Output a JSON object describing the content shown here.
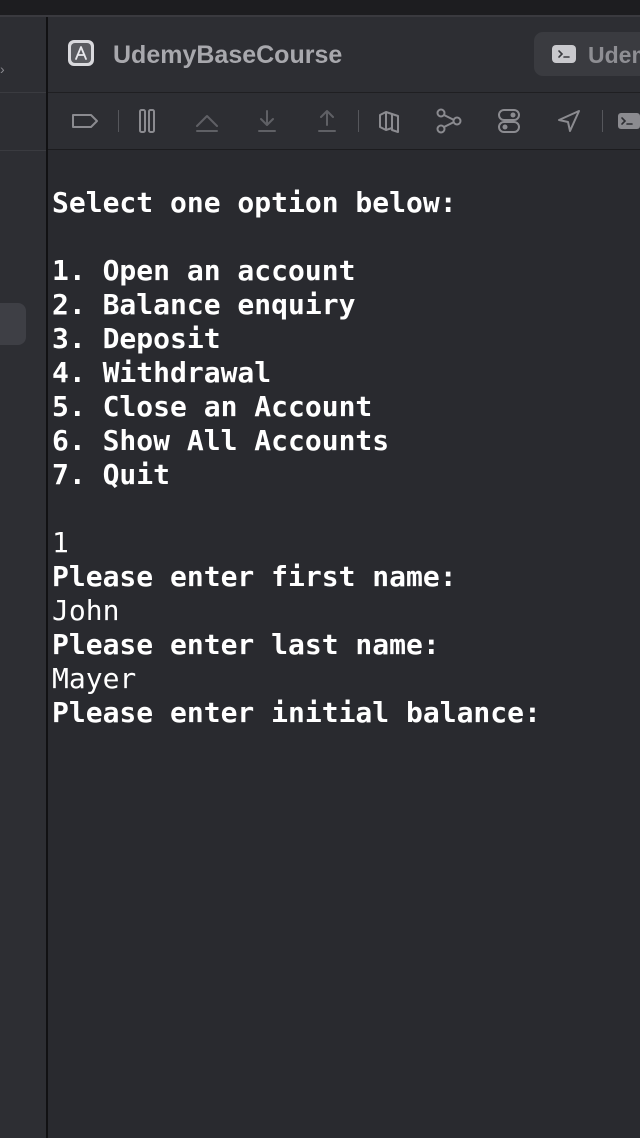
{
  "window": {
    "title": "UdemyBaseCourse"
  },
  "tab": {
    "label": "Udem",
    "icon": "terminal-icon"
  },
  "sidebar": {
    "icon": "chevron-icon"
  },
  "toolbar": {
    "icons": [
      "tag-icon",
      "pause-icon",
      "step-over-icon",
      "step-into-icon",
      "step-out-icon",
      "view-debugger-icon",
      "memory-graph-icon",
      "environment-toggle-icon",
      "location-icon",
      "terminal-icon"
    ]
  },
  "console": {
    "lines": [
      {
        "text": "Select one option below:",
        "bold": true
      },
      {
        "text": "",
        "bold": false
      },
      {
        "text": "1. Open an account",
        "bold": true
      },
      {
        "text": "2. Balance enquiry",
        "bold": true
      },
      {
        "text": "3. Deposit",
        "bold": true
      },
      {
        "text": "4. Withdrawal",
        "bold": true
      },
      {
        "text": "5. Close an Account",
        "bold": true
      },
      {
        "text": "6. Show All Accounts",
        "bold": true
      },
      {
        "text": "7. Quit",
        "bold": true
      },
      {
        "text": "",
        "bold": false
      },
      {
        "text": "1",
        "bold": false
      },
      {
        "text": "Please enter first name:",
        "bold": true
      },
      {
        "text": "John",
        "bold": false
      },
      {
        "text": "Please enter last name:",
        "bold": true
      },
      {
        "text": "Mayer",
        "bold": false
      },
      {
        "text": "Please enter initial balance:",
        "bold": true
      }
    ]
  }
}
